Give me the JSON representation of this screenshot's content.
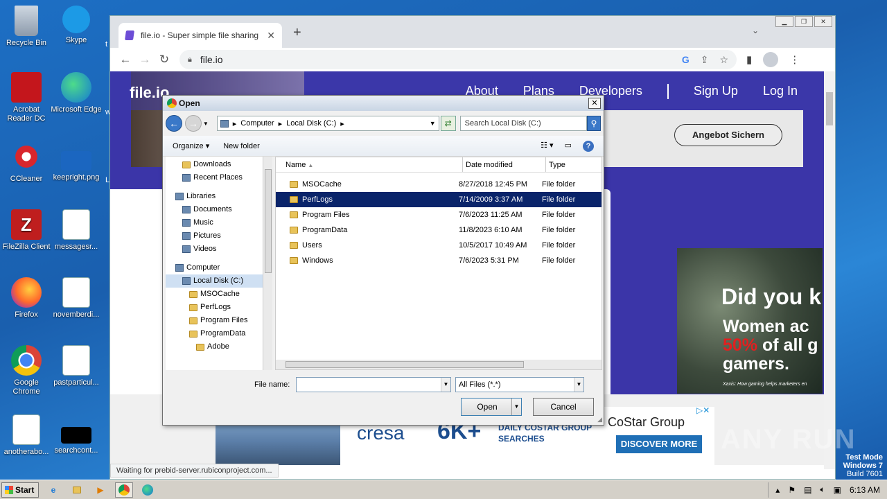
{
  "desktop": {
    "icons": [
      {
        "label": "Recycle Bin"
      },
      {
        "label": "Skype"
      },
      {
        "label": "Acrobat Reader DC"
      },
      {
        "label": "Microsoft Edge"
      },
      {
        "label": "CCleaner"
      },
      {
        "label": "keepright.png"
      },
      {
        "label": "FileZilla Client"
      },
      {
        "label": "messagesr..."
      },
      {
        "label": "Firefox"
      },
      {
        "label": "novemberdi..."
      },
      {
        "label": "Google Chrome"
      },
      {
        "label": "pastparticul..."
      },
      {
        "label": "anotherabo..."
      },
      {
        "label": "searchcont..."
      }
    ],
    "partial_labels": [
      "t",
      "w",
      "L"
    ]
  },
  "browser": {
    "tab_title": "file.io - Super simple file sharing",
    "url": "file.io",
    "status_text": "Waiting for prebid-server.rubiconproject.com..."
  },
  "site": {
    "logo": "file.io",
    "nav": [
      "About",
      "Plans",
      "Developers",
      "Sign Up",
      "Log In"
    ],
    "ad_button": "Angebot Sichern",
    "did_ad": {
      "headline": "Did you k",
      "line1": "Women ac",
      "line2_red": "50%",
      "line2_rest": " of all g",
      "line3": "gamers.",
      "footnote": "Xaxis: How gaming helps marketers en"
    },
    "cresa_ad": {
      "brand": "cresa",
      "big": "6K+",
      "line1": "DAILY COSTAR GROUP",
      "line2": "SEARCHES"
    },
    "costar_ad": {
      "brand": "CoStar Group",
      "button": "DISCOVER MORE"
    }
  },
  "dialog": {
    "title": "Open",
    "breadcrumb": [
      "Computer",
      "Local Disk (C:)"
    ],
    "search_placeholder": "Search Local Disk (C:)",
    "organize": "Organize",
    "new_folder": "New folder",
    "nav_items": [
      {
        "label": "Downloads",
        "indent": 2
      },
      {
        "label": "Recent Places",
        "indent": 2
      },
      {
        "label": "Libraries",
        "indent": 1
      },
      {
        "label": "Documents",
        "indent": 2
      },
      {
        "label": "Music",
        "indent": 2
      },
      {
        "label": "Pictures",
        "indent": 2
      },
      {
        "label": "Videos",
        "indent": 2
      },
      {
        "label": "Computer",
        "indent": 1
      },
      {
        "label": "Local Disk (C:)",
        "indent": 2
      },
      {
        "label": "MSOCache",
        "indent": 3
      },
      {
        "label": "PerfLogs",
        "indent": 3
      },
      {
        "label": "Program Files",
        "indent": 3
      },
      {
        "label": "ProgramData",
        "indent": 3
      },
      {
        "label": "Adobe",
        "indent": 4
      }
    ],
    "columns": [
      "Name",
      "Date modified",
      "Type"
    ],
    "files": [
      {
        "name": "MSOCache",
        "date": "8/27/2018 12:45 PM",
        "type": "File folder"
      },
      {
        "name": "PerfLogs",
        "date": "7/14/2009 3:37 AM",
        "type": "File folder"
      },
      {
        "name": "Program Files",
        "date": "7/6/2023 11:25 AM",
        "type": "File folder"
      },
      {
        "name": "ProgramData",
        "date": "11/8/2023 6:10 AM",
        "type": "File folder"
      },
      {
        "name": "Users",
        "date": "10/5/2017 10:49 AM",
        "type": "File folder"
      },
      {
        "name": "Windows",
        "date": "7/6/2023 5:31 PM",
        "type": "File folder"
      }
    ],
    "selected_index": 1,
    "file_name_label": "File name:",
    "file_name_value": "",
    "filter": "All Files (*.*)",
    "open_button": "Open",
    "cancel_button": "Cancel"
  },
  "taskbar": {
    "start": "Start",
    "clock": "6:13 AM"
  },
  "watermark": {
    "line1": "Test Mode",
    "line2": "Windows 7",
    "line3": "Build 7601"
  },
  "anyrun": "ANY RUN"
}
